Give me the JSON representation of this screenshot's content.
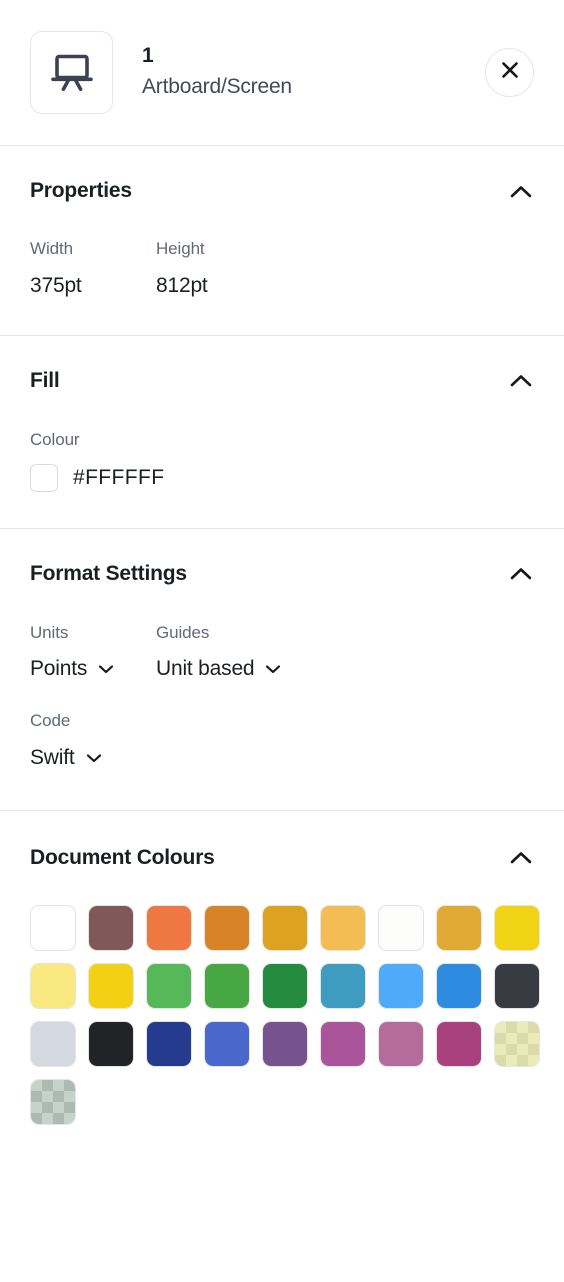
{
  "header": {
    "icon": "artboard-icon",
    "index": "1",
    "subtitle": "Artboard/Screen",
    "close_icon": "close-icon"
  },
  "properties": {
    "title": "Properties",
    "collapse_icon": "chevron-up-icon",
    "width_label": "Width",
    "width_value": "375pt",
    "height_label": "Height",
    "height_value": "812pt"
  },
  "fill": {
    "title": "Fill",
    "collapse_icon": "chevron-up-icon",
    "colour_label": "Colour",
    "colour_hex": "#FFFFFF",
    "swatch_color": "#FFFFFF"
  },
  "format_settings": {
    "title": "Format Settings",
    "collapse_icon": "chevron-up-icon",
    "units_label": "Units",
    "units_value": "Points",
    "guides_label": "Guides",
    "guides_value": "Unit based",
    "code_label": "Code",
    "code_value": "Swift",
    "caret_icon": "chevron-down-icon"
  },
  "document_colours": {
    "title": "Document Colours",
    "collapse_icon": "chevron-up-icon",
    "swatches": [
      {
        "hex": "#FFFFFF",
        "alpha": 1,
        "light": true
      },
      {
        "hex": "#80585A",
        "alpha": 1,
        "light": false
      },
      {
        "hex": "#EF7842",
        "alpha": 1,
        "light": false
      },
      {
        "hex": "#D98329",
        "alpha": 1,
        "light": false
      },
      {
        "hex": "#DEA221",
        "alpha": 1,
        "light": false
      },
      {
        "hex": "#F3BD54",
        "alpha": 1,
        "light": false
      },
      {
        "hex": "#FDFDFB",
        "alpha": 1,
        "light": true
      },
      {
        "hex": "#E0AA35",
        "alpha": 1,
        "light": false
      },
      {
        "hex": "#F0D314",
        "alpha": 1,
        "light": false
      },
      {
        "hex": "#FAE881",
        "alpha": 1,
        "light": false
      },
      {
        "hex": "#F2D014",
        "alpha": 1,
        "light": false
      },
      {
        "hex": "#57B85A",
        "alpha": 1,
        "light": false
      },
      {
        "hex": "#47A742",
        "alpha": 1,
        "light": false
      },
      {
        "hex": "#248A3D",
        "alpha": 1,
        "light": false
      },
      {
        "hex": "#3D9CBF",
        "alpha": 1,
        "light": false
      },
      {
        "hex": "#4FAAFA",
        "alpha": 1,
        "light": false
      },
      {
        "hex": "#2E8CE0",
        "alpha": 1,
        "light": false
      },
      {
        "hex": "#383C42",
        "alpha": 1,
        "light": false
      },
      {
        "hex": "#D4D9E1",
        "alpha": 1,
        "light": false
      },
      {
        "hex": "#222326",
        "alpha": 1,
        "light": false
      },
      {
        "hex": "#253C8E",
        "alpha": 1,
        "light": false
      },
      {
        "hex": "#4A68CB",
        "alpha": 1,
        "light": false
      },
      {
        "hex": "#76528E",
        "alpha": 1,
        "light": false
      },
      {
        "hex": "#A9549B",
        "alpha": 1,
        "light": false
      },
      {
        "hex": "#B46C9C",
        "alpha": 1,
        "light": false
      },
      {
        "hex": "#A8417D",
        "alpha": 1,
        "light": false
      },
      {
        "hex": "#DEDE8E",
        "alpha": 0.62,
        "light": false
      },
      {
        "hex": "#7E9E8A",
        "alpha": 0.45,
        "light": false
      }
    ]
  }
}
